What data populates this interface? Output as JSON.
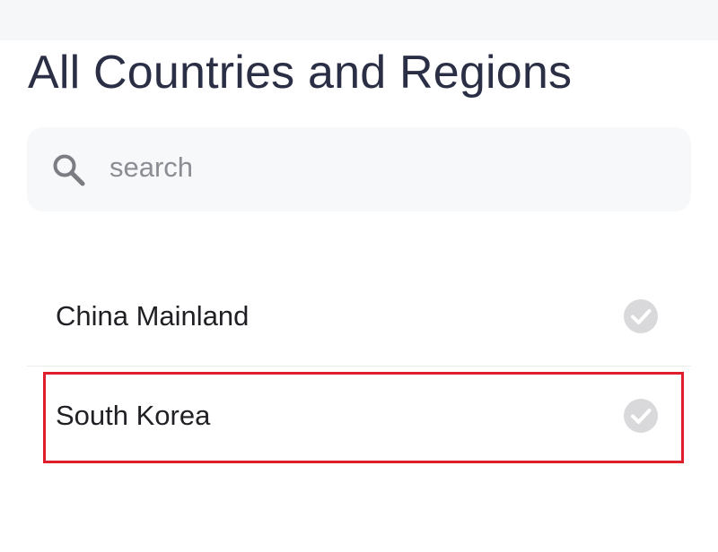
{
  "header": {
    "title": "All Countries and Regions"
  },
  "search": {
    "placeholder": "search",
    "value": "",
    "icon": "search-icon"
  },
  "list": {
    "items": [
      {
        "label": "China Mainland",
        "check_icon": "check-circle-icon",
        "selected": false
      },
      {
        "label": "South Korea",
        "check_icon": "check-circle-icon",
        "selected": false,
        "highlighted": true
      }
    ]
  },
  "colors": {
    "title": "#2b2f45",
    "search_bg": "#f7f8fa",
    "check_unselected": "#d9d9dc",
    "highlight": "#e01e2b"
  }
}
